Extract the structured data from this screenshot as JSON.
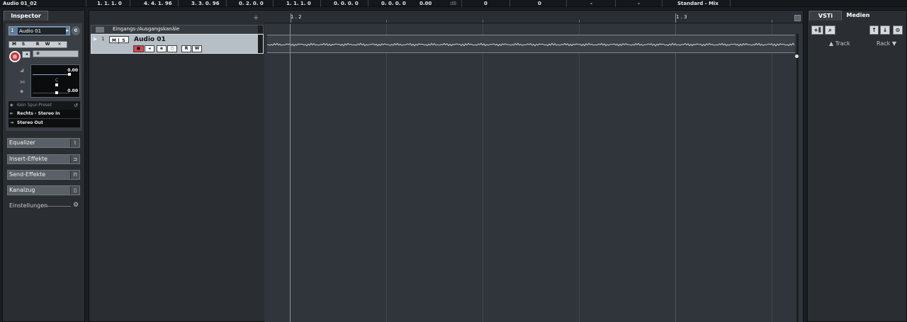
{
  "info_line": {
    "cells": [
      "Audio 01_02",
      "1. 1. 1.   0",
      "4. 4. 1. 96",
      "3. 3. 0. 96",
      "0. 2. 0.   0",
      "1. 1. 1.   0",
      "0. 0. 0.   0",
      "0. 0. 0.   0",
      "0.00",
      "dB",
      "0",
      "0",
      "-",
      "-",
      "Standard - Mix"
    ]
  },
  "inspector": {
    "tab": "Inspector",
    "track_number": "1",
    "track_name": "Audio 01",
    "edit_icon": "e",
    "buttons_row1": [
      "M",
      "S",
      "R",
      "W",
      "✕"
    ],
    "volume_value": "0.00",
    "pan_label": "C",
    "pan_value": "0.00",
    "preset": "Kein Spur-Preset",
    "input": "Rechts - Stereo In",
    "output": "Stereo Out",
    "sections": [
      "Equalizer",
      "Insert-Effekte",
      "Send-Effekte",
      "Kanalzug"
    ],
    "settings": "Einstellungen"
  },
  "project": {
    "add_track": "+",
    "folder_name": "Eingangs-/Ausgangskanäle",
    "track_number": "1",
    "track_name": "Audio 01",
    "track_buttons_top": [
      "M",
      "S"
    ],
    "track_buttons_bottom": [
      "●",
      "◂",
      "e",
      "○",
      "R",
      "W"
    ],
    "ruler_marks": [
      "1 . 2",
      "1 . 3"
    ]
  },
  "right_zone": {
    "tabs": [
      "VSTi",
      "Medien"
    ],
    "sort_track": "▲ Track",
    "sort_rack": "Rack ▼"
  },
  "colors": {
    "background": "#2a2e33",
    "record": "#c8303b",
    "track_selected": "#b6bec6",
    "volume_line": "#8aa7c7"
  }
}
